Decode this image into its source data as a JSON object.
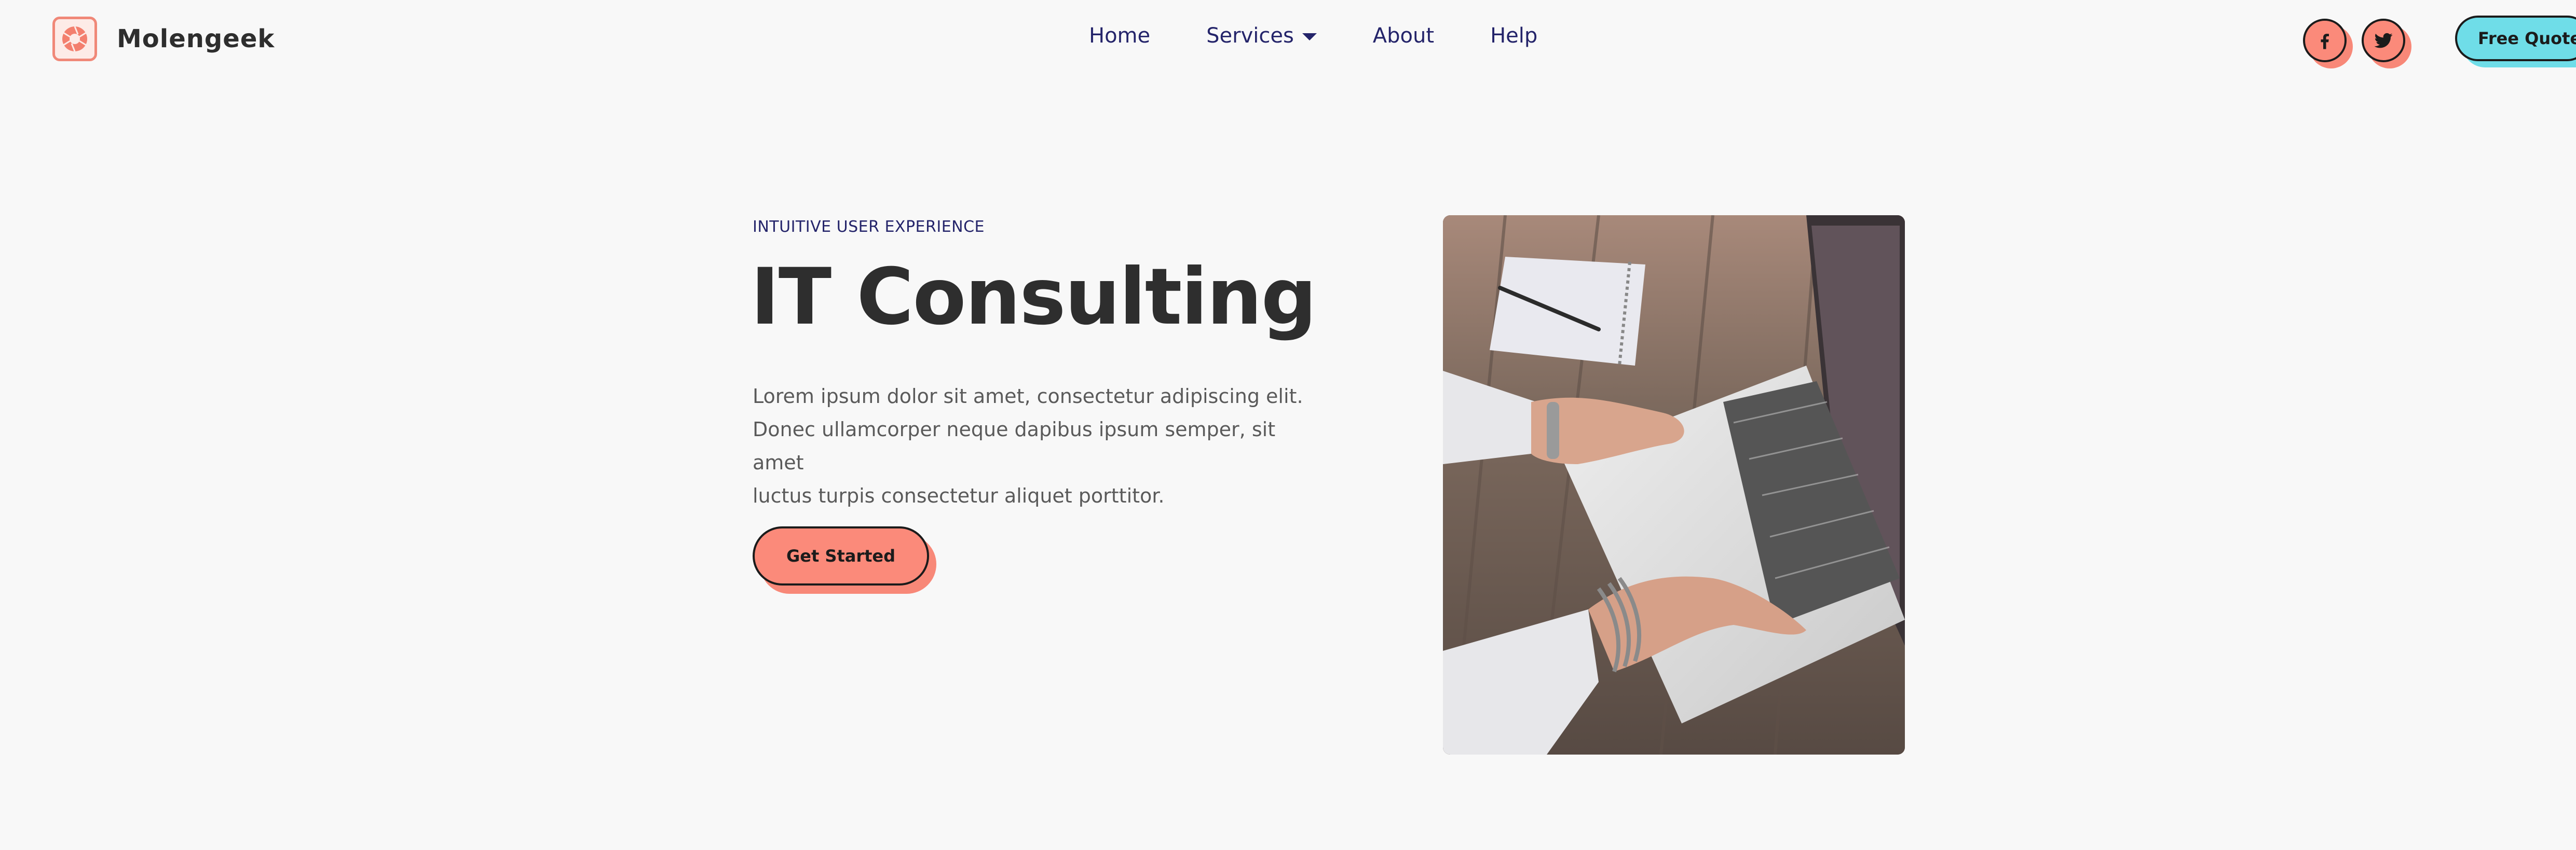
{
  "brand": {
    "name": "Molengeek",
    "logo_icon": "aperture-logo-icon"
  },
  "nav": {
    "items": [
      {
        "label": "Home"
      },
      {
        "label": "Services",
        "has_dropdown": true
      },
      {
        "label": "About"
      },
      {
        "label": "Help"
      }
    ]
  },
  "social": [
    {
      "icon": "facebook-icon"
    },
    {
      "icon": "twitter-icon"
    }
  ],
  "cta_quote": {
    "label": "Free Quote"
  },
  "hero": {
    "eyebrow": "INTUITIVE USER EXPERIENCE",
    "title": "IT Consulting",
    "text_lines": [
      "Lorem ipsum dolor sit amet, consectetur adipiscing elit.",
      "Donec ullamcorper neque dapibus ipsum semper, sit amet",
      "luctus turpis consectetur aliquet porttitor."
    ],
    "button_label": "Get Started"
  },
  "colors": {
    "background": "#f8f8f8",
    "nav_text": "#24246a",
    "heading": "#2e2e2e",
    "body_text": "#5a5a5a",
    "accent_salmon": "#fb8a7a",
    "accent_cyan": "#6fdde8",
    "outline": "#1b1b1b"
  }
}
